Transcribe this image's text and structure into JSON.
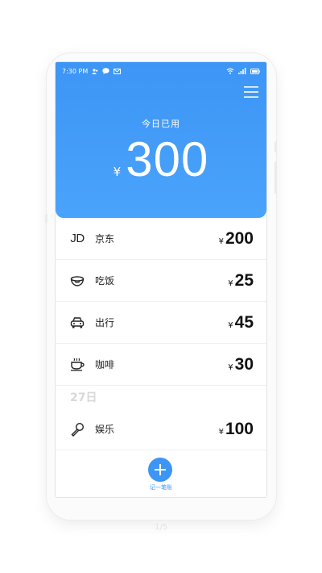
{
  "status_bar": {
    "time": "7:30 PM"
  },
  "header": {
    "today_label": "今日已用",
    "currency": "¥",
    "today_total": "300"
  },
  "entries": [
    {
      "icon": "jd-logo-icon",
      "icon_text": "JD",
      "label": "京东",
      "currency": "¥",
      "amount": "200"
    },
    {
      "icon": "rice-bowl-icon",
      "label": "吃饭",
      "currency": "¥",
      "amount": "25"
    },
    {
      "icon": "car-icon",
      "label": "出行",
      "currency": "¥",
      "amount": "45"
    },
    {
      "icon": "coffee-cup-icon",
      "label": "咖啡",
      "currency": "¥",
      "amount": "30"
    }
  ],
  "date_separator": "27日",
  "entries_earlier": [
    {
      "icon": "microphone-icon",
      "label": "娱乐",
      "currency": "¥",
      "amount": "100"
    }
  ],
  "add_button": {
    "label": "记一笔账"
  },
  "pager": {
    "text": "1/5"
  },
  "colors": {
    "accent": "#3d95f5",
    "header_top": "#3d95f5",
    "header_bottom": "#4aa3fb"
  }
}
